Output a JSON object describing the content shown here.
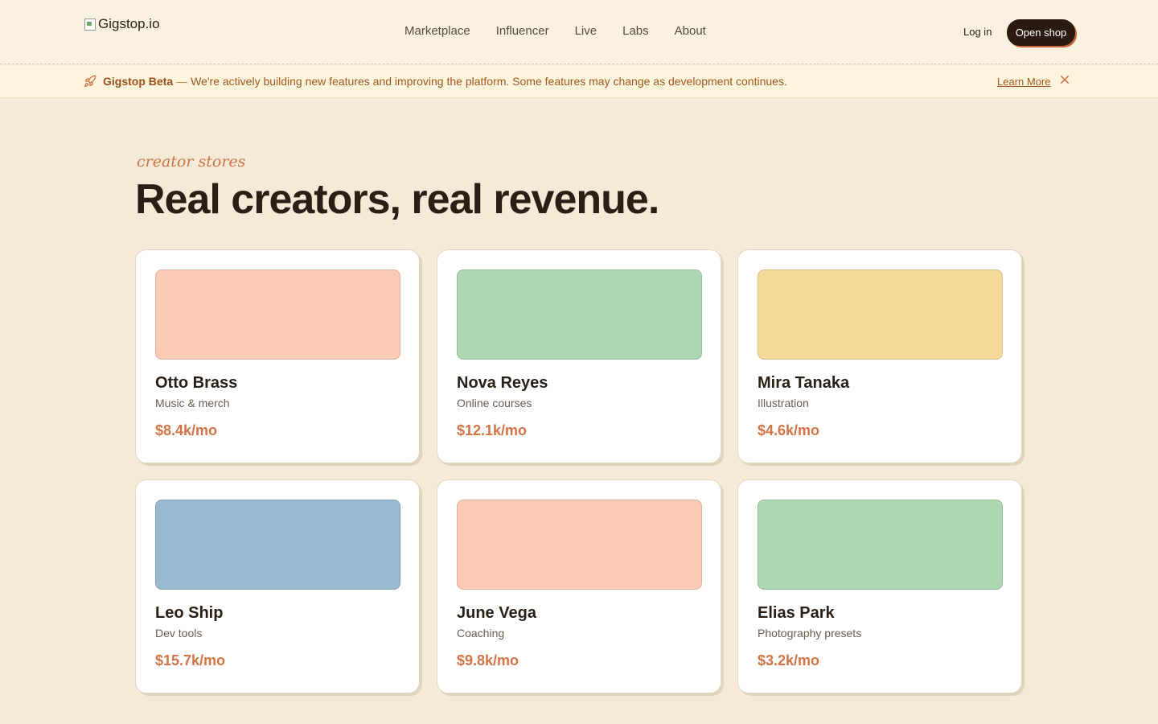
{
  "header": {
    "logo_alt": "Gigstop.io",
    "nav": [
      "Marketplace",
      "Influencer",
      "Live",
      "Labs",
      "About"
    ],
    "login_label": "Log in",
    "cta_label": "Open shop"
  },
  "banner": {
    "title": "Gigstop Beta",
    "dash": "—",
    "message": "We're actively building new features and improving the platform. Some features may change as development continues.",
    "learn_more": "Learn More",
    "icon": "rocket-icon",
    "close_icon": "close-icon"
  },
  "hero": {
    "eyebrow": "creator stores",
    "headline": "Real creators, real revenue."
  },
  "creators": [
    {
      "name": "Otto Brass",
      "category": "Music & merch",
      "revenue": "$8.4k/mo",
      "color": "#fdcbb4"
    },
    {
      "name": "Nova Reyes",
      "category": "Online courses",
      "revenue": "$12.1k/mo",
      "color": "#acd7b2"
    },
    {
      "name": "Mira Tanaka",
      "category": "Illustration",
      "revenue": "$4.6k/mo",
      "color": "#f7da9a"
    },
    {
      "name": "Leo Ship",
      "category": "Dev tools",
      "revenue": "$15.7k/mo",
      "color": "#98b9cf"
    },
    {
      "name": "June Vega",
      "category": "Coaching",
      "revenue": "$9.8k/mo",
      "color": "#fdcbb4"
    },
    {
      "name": "Elias Park",
      "category": "Photography presets",
      "revenue": "$3.2k/mo",
      "color": "#acd7b2"
    }
  ]
}
